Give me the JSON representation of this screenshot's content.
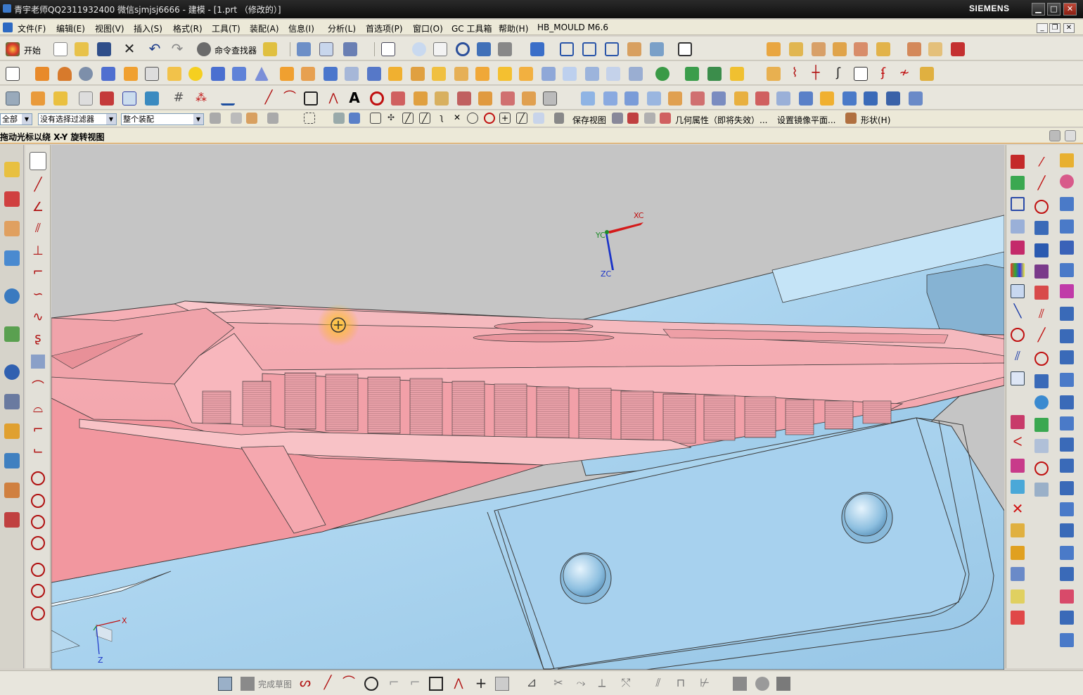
{
  "window": {
    "title": "青宇老师QQ2311932400 微信sjmjsj6666 - 建模 - [1.prt （修改的）]",
    "brand": "SIEMENS",
    "minimize": "▁",
    "maximize": "□",
    "close": "✕"
  },
  "menu": {
    "items": [
      "文件(F)",
      "编辑(E)",
      "视图(V)",
      "插入(S)",
      "格式(R)",
      "工具(T)",
      "装配(A)",
      "信息(I)",
      "分析(L)",
      "首选项(P)",
      "窗口(O)",
      "GC 工具箱",
      "帮助(H)",
      "HB_MOULD M6.6"
    ]
  },
  "toolbar": {
    "start_label": "开始",
    "command_finder_label": "命令查找器"
  },
  "selection_bar": {
    "type_filter": "全部",
    "selection_filter": "没有选择过滤器",
    "scope": "整个装配",
    "save_view": "保存视图",
    "geometry_props": "几何属性（即将失效）...",
    "mirror_plane": "设置镜像平面...",
    "shape_menu": "形状(H)"
  },
  "cue": {
    "text": "拖动光标以绕 X-Y 旋转视图"
  },
  "viewport": {
    "wcs_labels": {
      "x": "XC",
      "y": "YC",
      "z": "ZC"
    },
    "abs_labels": {
      "x": "X",
      "z": "Z"
    },
    "colors": {
      "background": "#c5c5c5",
      "pink_part": "#f2a4ab",
      "blue_part": "#a9d3ef",
      "edge": "#3a3a3a"
    }
  },
  "bottom_toolbar": {
    "finish_sketch": "完成草图"
  }
}
